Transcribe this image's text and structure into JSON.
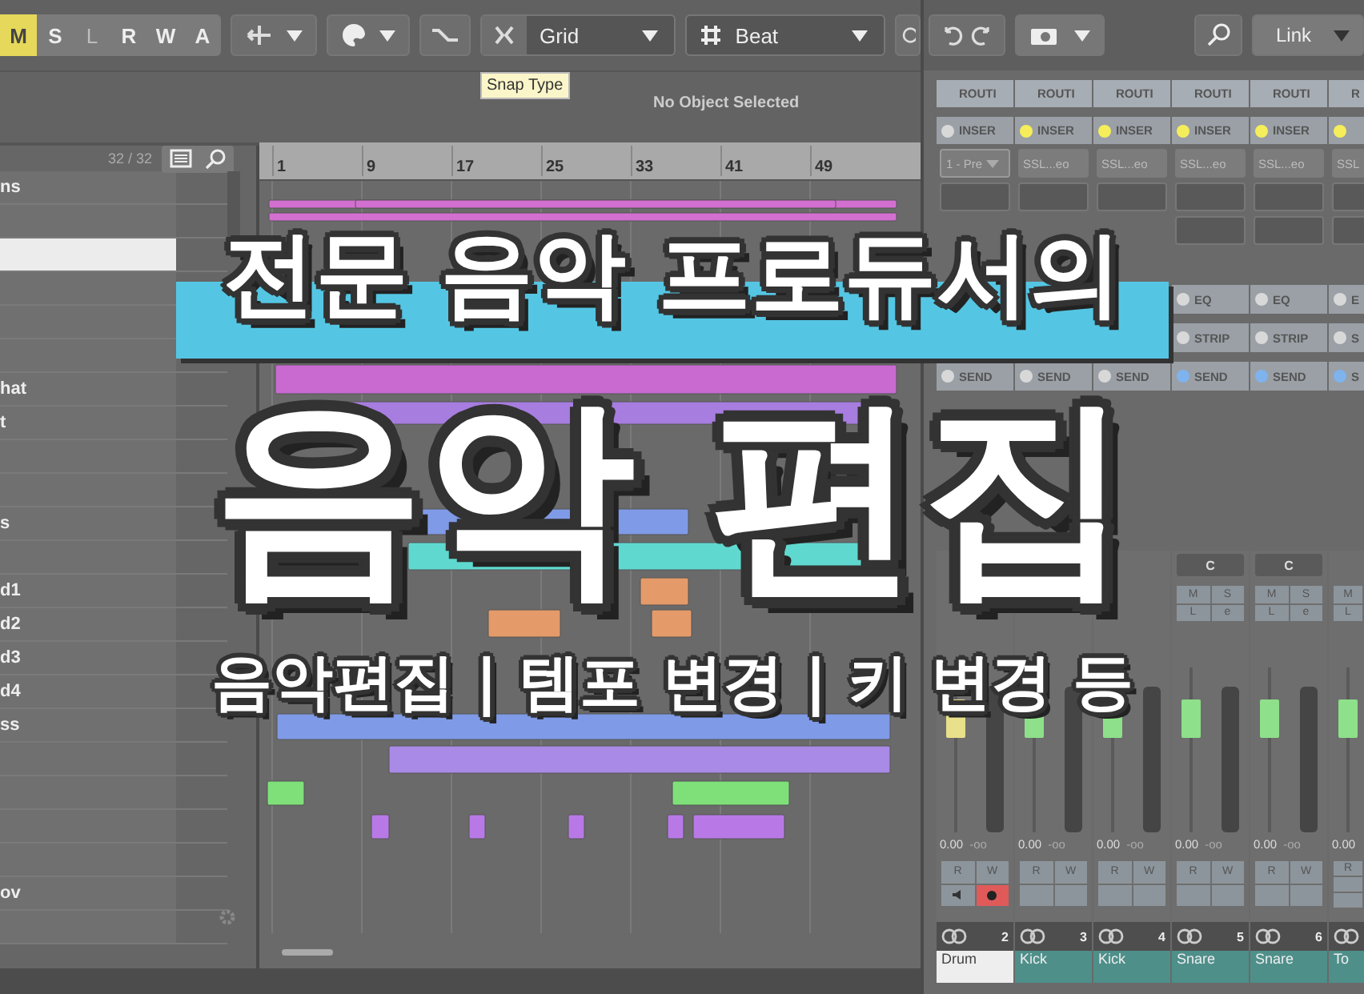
{
  "toolbar": {
    "mode_buttons": [
      {
        "label": "M",
        "selected": true,
        "disabled": false
      },
      {
        "label": "S",
        "selected": false,
        "disabled": false
      },
      {
        "label": "L",
        "selected": false,
        "disabled": true
      },
      {
        "label": "R",
        "selected": false,
        "disabled": false
      },
      {
        "label": "W",
        "selected": false,
        "disabled": false
      },
      {
        "label": "A",
        "selected": false,
        "disabled": false
      }
    ],
    "snap_type": {
      "value": "Grid"
    },
    "grid_unit": {
      "value": "Beat"
    },
    "tooltip": "Snap Type",
    "info": "No Object Selected"
  },
  "track_list": {
    "count": "32 / 32",
    "tracks": [
      {
        "name": "ns",
        "selected": false
      },
      {
        "selected": false
      },
      {
        "selected": true
      },
      {
        "selected": false
      },
      {
        "selected": false
      },
      {
        "selected": false
      },
      {
        "name": "hat",
        "selected": false
      },
      {
        "name": "t",
        "selected": false
      },
      {
        "selected": false
      },
      {
        "selected": false
      },
      {
        "name": "s",
        "selected": false
      },
      {
        "selected": false
      },
      {
        "name": "d1",
        "selected": false
      },
      {
        "name": "d2",
        "selected": false
      },
      {
        "name": "d3",
        "selected": false
      },
      {
        "name": "d4",
        "selected": false
      },
      {
        "name": "ss",
        "selected": false
      },
      {
        "selected": false
      },
      {
        "selected": false
      },
      {
        "selected": false
      },
      {
        "selected": false
      },
      {
        "name": "ov",
        "selected": false
      },
      {
        "selected": false
      }
    ]
  },
  "ruler": {
    "marks": [
      "1",
      "9",
      "17",
      "25",
      "33",
      "41",
      "49"
    ]
  },
  "mixer_toolbar": {
    "link": {
      "value": "Link"
    }
  },
  "mixer": {
    "channels": [
      {
        "routing": "ROUTI",
        "insert": {
          "label": "INSER",
          "on": false
        },
        "slots": [
          {
            "kind": "preset",
            "text": "1 - Pre"
          },
          {
            "kind": "empty"
          }
        ],
        "send": {
          "label": "SEND",
          "on": false
        },
        "color": "#e8e08a",
        "level": 0.75,
        "value": "0.00",
        "meter": "-oo",
        "rw": [
          "R",
          "W"
        ],
        "monitor": true,
        "record": true,
        "number": "2",
        "name": "Drum",
        "selected": true
      },
      {
        "routing": "ROUTI",
        "insert": {
          "label": "INSER",
          "on": true
        },
        "slots": [
          {
            "kind": "plugin",
            "text": "SSL...eo"
          },
          {
            "kind": "empty"
          }
        ],
        "send": {
          "label": "SEND",
          "on": false
        },
        "color": "#8ee08a",
        "level": 0.75,
        "value": "0.00",
        "meter": "-oo",
        "rw": [
          "R",
          "W"
        ],
        "monitor": false,
        "record": false,
        "number": "3",
        "name": "Kick",
        "selected": false
      },
      {
        "routing": "ROUTI",
        "insert": {
          "label": "INSER",
          "on": true
        },
        "slots": [
          {
            "kind": "plugin",
            "text": "SSL...eo"
          },
          {
            "kind": "empty"
          }
        ],
        "send": {
          "label": "SEND",
          "on": false
        },
        "color": "#8ee08a",
        "level": 0.75,
        "value": "0.00",
        "meter": "-oo",
        "rw": [
          "R",
          "W"
        ],
        "monitor": false,
        "record": false,
        "number": "4",
        "name": "Kick",
        "selected": false
      },
      {
        "routing": "ROUTI",
        "insert": {
          "label": "INSER",
          "on": true
        },
        "slots": [
          {
            "kind": "plugin",
            "text": "SSL...eo"
          },
          {
            "kind": "empty"
          },
          {
            "kind": "empty"
          }
        ],
        "eq": {
          "label": "EQ",
          "on": false
        },
        "strip": {
          "label": "STRIP",
          "on": false
        },
        "send": {
          "label": "SEND",
          "on": true
        },
        "pan": "C",
        "buttons": [
          "M",
          "S",
          "L",
          "e"
        ],
        "color": "#8ee08a",
        "level": 0.75,
        "value": "0.00",
        "meter": "-oo",
        "rw": [
          "R",
          "W"
        ],
        "monitor": false,
        "record": false,
        "number": "5",
        "name": "Snare",
        "selected": false
      },
      {
        "routing": "ROUTI",
        "insert": {
          "label": "INSER",
          "on": true
        },
        "slots": [
          {
            "kind": "plugin",
            "text": "SSL...eo"
          },
          {
            "kind": "empty"
          },
          {
            "kind": "empty"
          }
        ],
        "eq": {
          "label": "EQ",
          "on": false
        },
        "strip": {
          "label": "STRIP",
          "on": false
        },
        "send": {
          "label": "SEND",
          "on": true
        },
        "pan": "C",
        "buttons": [
          "M",
          "S",
          "L",
          "e"
        ],
        "color": "#8ee08a",
        "level": 0.75,
        "value": "0.00",
        "meter": "-oo",
        "rw": [
          "R",
          "W"
        ],
        "monitor": false,
        "record": false,
        "number": "6",
        "name": "Snare",
        "selected": false
      },
      {
        "routing": "R",
        "insert": {
          "on": true
        },
        "slots": [
          {
            "kind": "plugin",
            "text": "SSL"
          },
          {
            "kind": "empty"
          },
          {
            "kind": "empty"
          }
        ],
        "eq": {
          "label": "E",
          "on": false
        },
        "strip": {
          "label": "S",
          "on": false
        },
        "send": {
          "label": "S",
          "on": true
        },
        "buttons": [
          "M",
          "L"
        ],
        "color": "#8ee08a",
        "level": 0.75,
        "value": "0.00",
        "rw": [
          "R"
        ],
        "monitor": false,
        "record": false,
        "name": "To",
        "selected": false
      }
    ]
  },
  "overlay": {
    "title": "전문 음악 프로듀서의",
    "headline": "음악 편집",
    "subtitle": "음악편집 | 템포 변경 | 키 변경 등"
  }
}
